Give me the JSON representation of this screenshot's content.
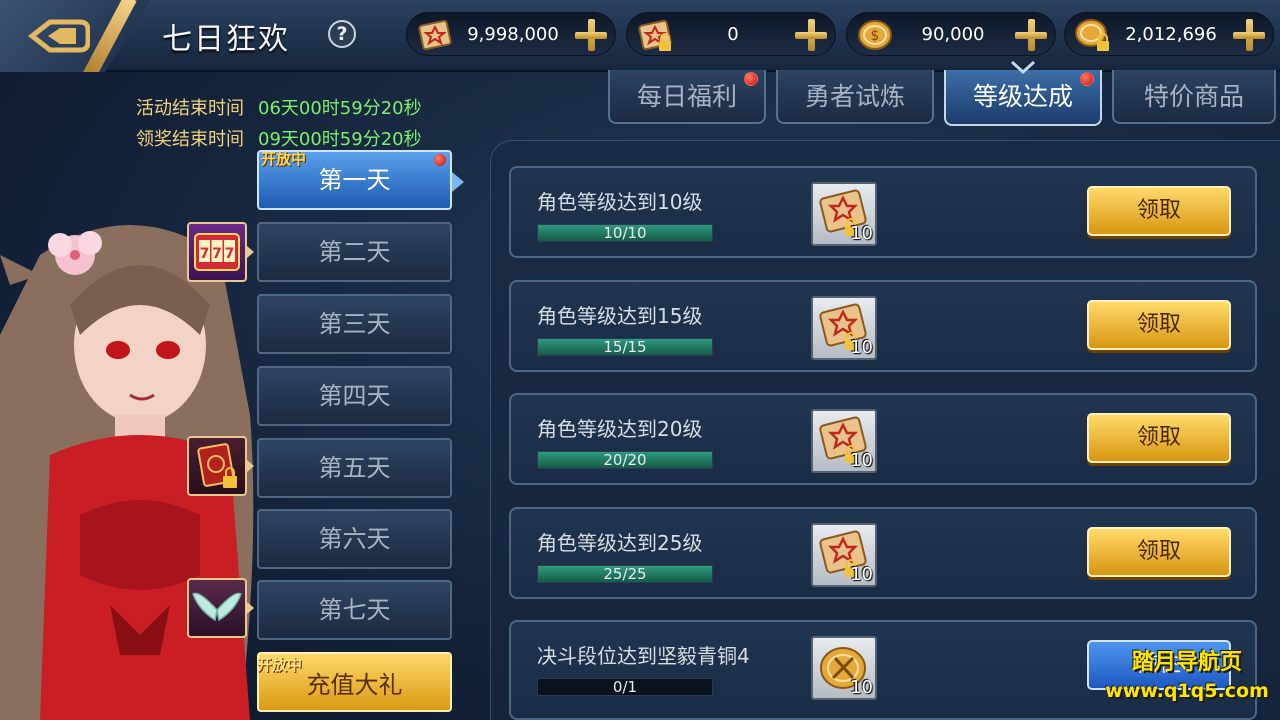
{
  "header": {
    "title": "七日狂欢",
    "help_symbol": "?",
    "currencies": [
      {
        "icon": "scroll-icon",
        "value": "9,998,000"
      },
      {
        "icon": "locked-scroll-icon",
        "value": "0"
      },
      {
        "icon": "gold-coin-icon",
        "value": "90,000"
      },
      {
        "icon": "locked-coin-icon",
        "value": "2,012,696"
      }
    ]
  },
  "tabs": [
    {
      "label": "每日福利",
      "badge": true,
      "active": false
    },
    {
      "label": "勇者试炼",
      "badge": false,
      "active": false
    },
    {
      "label": "等级达成",
      "badge": true,
      "active": true
    },
    {
      "label": "特价商品",
      "badge": false,
      "active": false
    }
  ],
  "timers": {
    "event_end_label": "活动结束时间",
    "event_end_value": "06天00时59分20秒",
    "claim_end_label": "领奖结束时间",
    "claim_end_value": "09天00时59分20秒"
  },
  "days": {
    "open_tag": "开放中",
    "items": [
      "第一天",
      "第二天",
      "第三天",
      "第四天",
      "第五天",
      "第六天",
      "第七天"
    ],
    "active_index": 0,
    "recharge_label": "充值大礼",
    "recharge_tag": "开放中",
    "side_rewards": [
      {
        "icon": "slot-777-icon"
      },
      {
        "icon": "locked-book-icon"
      },
      {
        "icon": "wings-icon"
      }
    ]
  },
  "tasks": [
    {
      "name": "角色等级达到10级",
      "progress": "10/10",
      "fraction": 1.0,
      "reward_icon": "locked-scroll-icon",
      "reward_count": "10",
      "button": "领取",
      "button_type": "claim"
    },
    {
      "name": "角色等级达到15级",
      "progress": "15/15",
      "fraction": 1.0,
      "reward_icon": "locked-scroll-icon",
      "reward_count": "10",
      "button": "领取",
      "button_type": "claim"
    },
    {
      "name": "角色等级达到20级",
      "progress": "20/20",
      "fraction": 1.0,
      "reward_icon": "locked-scroll-icon",
      "reward_count": "10",
      "button": "领取",
      "button_type": "claim"
    },
    {
      "name": "角色等级达到25级",
      "progress": "25/25",
      "fraction": 1.0,
      "reward_icon": "locked-scroll-icon",
      "reward_count": "10",
      "button": "领取",
      "button_type": "claim"
    },
    {
      "name": "决斗段位达到坚毅青铜4",
      "progress": "0/1",
      "fraction": 0.0,
      "reward_icon": "duel-coin-icon",
      "reward_count": "10",
      "button": "前往",
      "button_type": "goto"
    }
  ],
  "watermark": {
    "line1": "踏月导航页",
    "line2": "www.q1q5.com"
  },
  "colors": {
    "timer_label": "#f0d27e",
    "timer_value": "#7cf06a",
    "progress_fill": "#2f9a7c",
    "claim_button": "#f1b52c",
    "badge_red": "#d5180c"
  }
}
